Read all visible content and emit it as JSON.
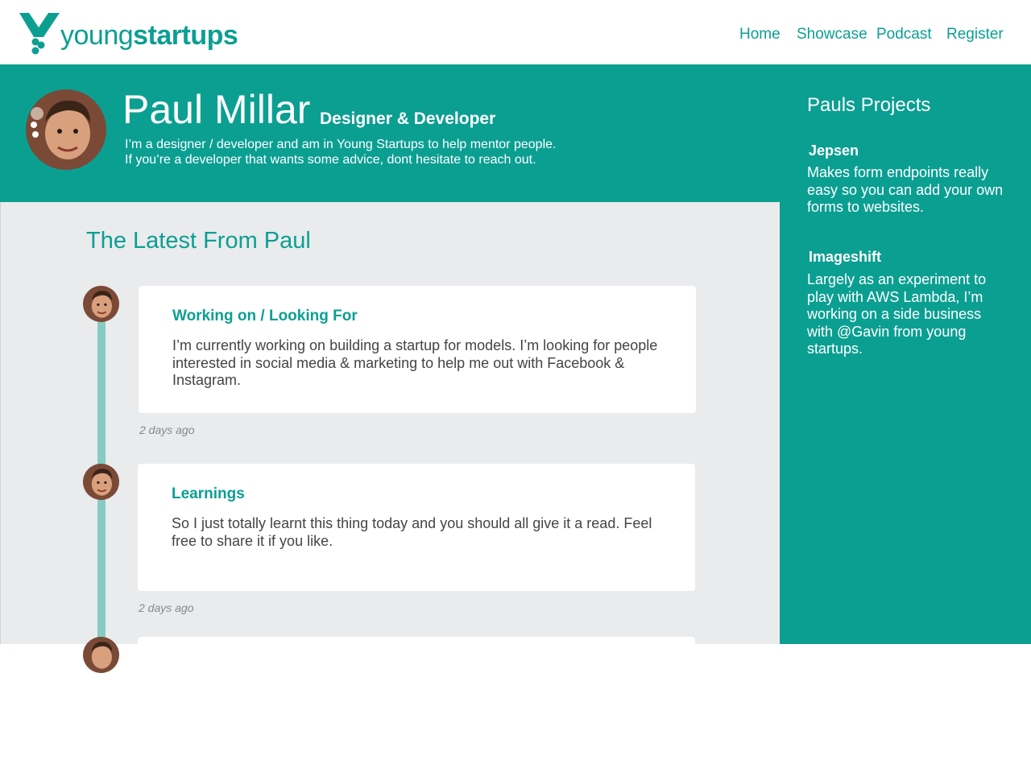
{
  "brand": {
    "logo_light": "young",
    "logo_bold": "startups",
    "accent_color": "#0b9f92",
    "timeline_color": "#87cbc3"
  },
  "nav": {
    "items": [
      {
        "label": "Home"
      },
      {
        "label": "Showcase"
      },
      {
        "label": "Podcast"
      },
      {
        "label": "Register"
      }
    ]
  },
  "profile": {
    "name": "Paul Millar",
    "role": "Designer & Developer",
    "bio_line1": "I’m a designer / developer and am in Young Startups to help mentor people.",
    "bio_line2": "If you’re a developer that wants some advice, dont hesitate to reach out."
  },
  "sidebar": {
    "title": "Pauls Projects",
    "projects": [
      {
        "name": "Jepsen",
        "description": "Makes form endpoints really easy so you can add your own forms to websites."
      },
      {
        "name": "Imageshift",
        "description": "Largely as an experiment to play with AWS Lambda, I’m working on  a side business with @Gavin from young startups."
      }
    ]
  },
  "feed": {
    "title": "The Latest From Paul",
    "posts": [
      {
        "title": "Working on / Looking For",
        "body": "I’m currently working on building a startup for models. I’m looking for people interested in social media & marketing to help me out with Facebook & Instagram.",
        "time": "2 days ago"
      },
      {
        "title": "Learnings",
        "body": "So I just totally learnt this thing today and you should all give it a read. Feel free to share it if you like.",
        "time": "2 days ago"
      }
    ]
  }
}
